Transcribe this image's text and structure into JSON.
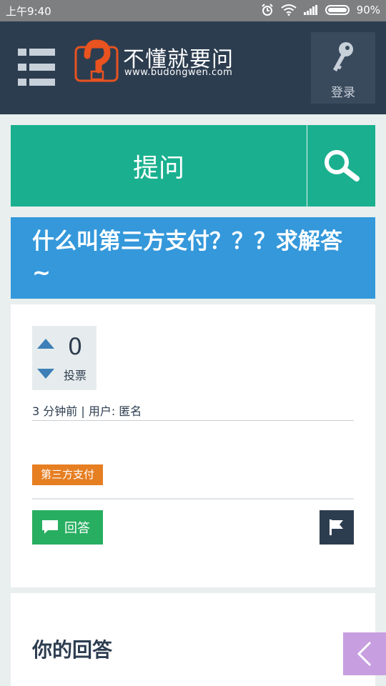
{
  "status_bar": {
    "time": "上午9:40",
    "battery": "90%",
    "icons": [
      "alarm-icon",
      "wifi-icon",
      "signal-icon",
      "battery-icon"
    ]
  },
  "header": {
    "menu_icon": "menu-icon",
    "logo_title": "不懂就要问",
    "logo_url": "www.budongwen.com",
    "login_label": "登录",
    "login_icon": "key-icon"
  },
  "actions": {
    "ask_label": "提问",
    "search_icon": "search-icon"
  },
  "question": {
    "title": "什么叫第三方支付？？？求解答~",
    "votes": "0",
    "votes_label": "投票",
    "meta": "3 分钟前 | 用户: 匿名",
    "tag": "第三方支付",
    "answer_label": "回答",
    "flag_icon": "flag-icon"
  },
  "answer_section": {
    "heading": "你的回答"
  },
  "colors": {
    "header_bg": "#2d3d50",
    "ask_green": "#1ab08f",
    "title_blue": "#3498db",
    "tag_orange": "#e67e22",
    "answer_green": "#27ae60",
    "logo_orange": "#e8531f",
    "back_tab": "#c79fe0"
  }
}
